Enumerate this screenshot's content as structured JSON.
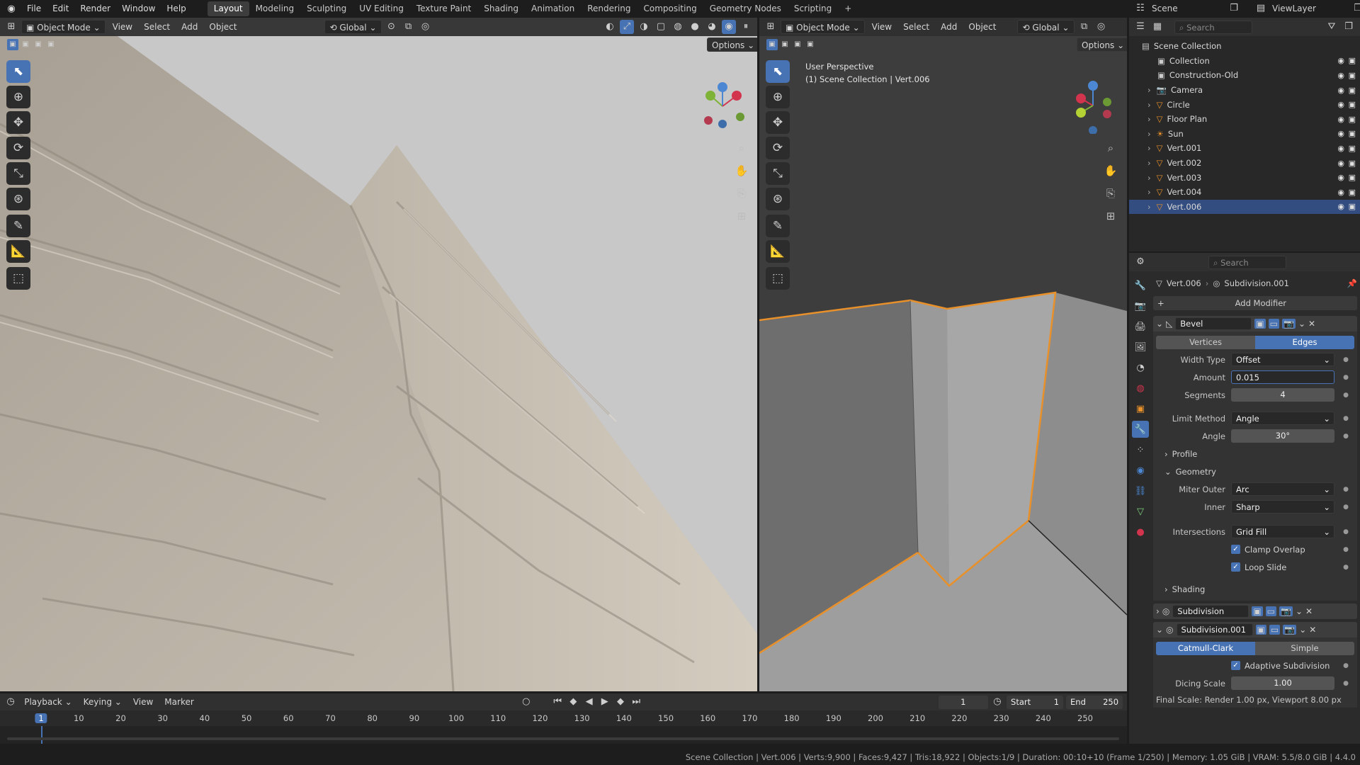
{
  "topbar": {
    "menus": [
      "File",
      "Edit",
      "Render",
      "Window",
      "Help"
    ],
    "workspaces": [
      "Layout",
      "Modeling",
      "Sculpting",
      "UV Editing",
      "Texture Paint",
      "Shading",
      "Animation",
      "Rendering",
      "Compositing",
      "Geometry Nodes",
      "Scripting"
    ],
    "active_workspace": "Layout",
    "scene_name": "Scene",
    "view_layer": "ViewLayer"
  },
  "viewport_left": {
    "mode": "Object Mode",
    "menus": [
      "View",
      "Select",
      "Add",
      "Object"
    ],
    "orientation": "Global",
    "options_label": "Options",
    "stone_color": "#bdb5a8",
    "bg_color": "#c8c8c8"
  },
  "viewport_right": {
    "mode": "Object Mode",
    "menus": [
      "View",
      "Select",
      "Add",
      "Object"
    ],
    "orientation": "Global",
    "options_label": "Options",
    "info_line1": "User Perspective",
    "info_line2": "(1) Scene Collection | Vert.006",
    "selection_color": "#e8902a"
  },
  "outliner": {
    "search_placeholder": "Search",
    "root": "Scene Collection",
    "items": [
      {
        "name": "Collection",
        "icon": "collection-icon"
      },
      {
        "name": "Construction-Old",
        "icon": "collection-icon"
      },
      {
        "name": "Camera",
        "icon": "camera-icon"
      },
      {
        "name": "Circle",
        "icon": "mesh-icon"
      },
      {
        "name": "Floor Plan",
        "icon": "mesh-icon"
      },
      {
        "name": "Sun",
        "icon": "light-icon"
      },
      {
        "name": "Vert.001",
        "icon": "mesh-icon"
      },
      {
        "name": "Vert.002",
        "icon": "mesh-icon"
      },
      {
        "name": "Vert.003",
        "icon": "mesh-icon"
      },
      {
        "name": "Vert.004",
        "icon": "mesh-icon"
      },
      {
        "name": "Vert.006",
        "icon": "mesh-icon"
      }
    ],
    "selected": "Vert.006"
  },
  "properties": {
    "search_placeholder": "Search",
    "breadcrumb_object": "Vert.006",
    "breadcrumb_modifier": "Subdivision.001",
    "add_modifier": "Add Modifier",
    "bevel": {
      "name": "Bevel",
      "tab_vertices": "Vertices",
      "tab_edges": "Edges",
      "width_type_label": "Width Type",
      "width_type": "Offset",
      "amount_label": "Amount",
      "amount": "0.015",
      "segments_label": "Segments",
      "segments": "4",
      "limit_method_label": "Limit Method",
      "limit_method": "Angle",
      "angle_label": "Angle",
      "angle": "30°",
      "profile_label": "Profile",
      "geometry_label": "Geometry",
      "miter_outer_label": "Miter Outer",
      "miter_outer": "Arc",
      "inner_label": "Inner",
      "inner": "Sharp",
      "intersections_label": "Intersections",
      "intersections": "Grid Fill",
      "clamp_overlap": "Clamp Overlap",
      "loop_slide": "Loop Slide",
      "shading_label": "Shading"
    },
    "subdivision": {
      "name": "Subdivision"
    },
    "subdivision001": {
      "name": "Subdivision.001",
      "tab_catmull": "Catmull-Clark",
      "tab_simple": "Simple",
      "adaptive": "Adaptive Subdivision",
      "dicing_label": "Dicing Scale",
      "dicing": "1.00",
      "final_scale": "Final Scale: Render 1.00 px, Viewport 8.00 px"
    }
  },
  "timeline": {
    "menus": [
      "Playback",
      "Keying",
      "View",
      "Marker"
    ],
    "current_frame": "1",
    "start_label": "Start",
    "start": "1",
    "end_label": "End",
    "end": "250",
    "ticks": [
      "1",
      "10",
      "20",
      "30",
      "40",
      "50",
      "60",
      "70",
      "80",
      "90",
      "100",
      "110",
      "120",
      "130",
      "140",
      "150",
      "160",
      "170",
      "180",
      "190",
      "200",
      "210",
      "220",
      "230",
      "240",
      "250"
    ]
  },
  "statusbar": {
    "text": "Scene Collection | Vert.006 | Verts:9,900 | Faces:9,427 | Tris:18,922 | Objects:1/9 | Duration: 00:10+10 (Frame 1/250) | Memory: 1.05 GiB | VRAM: 5.5/8.0 GiB | 4.4.0"
  }
}
